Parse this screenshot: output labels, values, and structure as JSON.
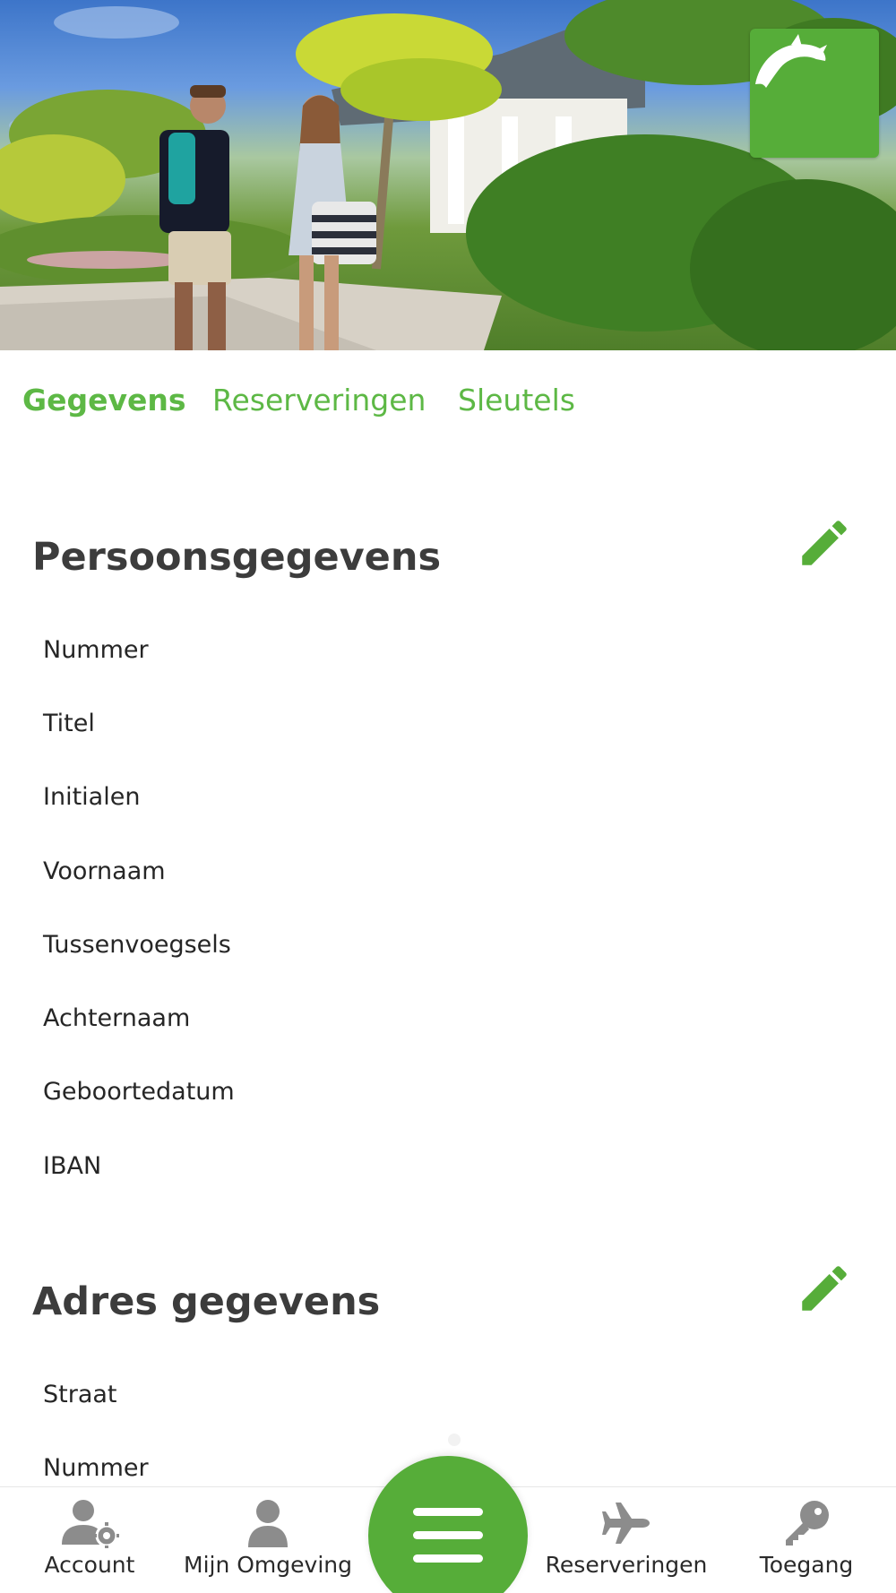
{
  "tabs": [
    "Gegevens",
    "Reserveringen",
    "Sleutels"
  ],
  "active_tab": "Gegevens",
  "personal": {
    "title": "Persoonsgegevens",
    "fields": [
      "Nummer",
      "Titel",
      "Initialen",
      "Voornaam",
      "Tussenvoegsels",
      "Achternaam",
      "Geboortedatum",
      "IBAN"
    ]
  },
  "address": {
    "title": "Adres gegevens",
    "fields": [
      "Straat",
      "Nummer"
    ]
  },
  "bottom_nav": {
    "account": "Account",
    "omgeving": "Mijn Omgeving",
    "reserveringen": "Reserveringen",
    "toegang": "Toegang"
  },
  "icons": {
    "logo": "dolphin-icon",
    "edit": "pencil-icon",
    "menu": "hamburger-menu-icon",
    "account": "user-gear-icon",
    "omgeving": "user-icon",
    "reserveringen": "airplane-icon",
    "toegang": "key-icon"
  },
  "colors": {
    "accent": "#56ad39",
    "tab_text": "#5db845",
    "heading": "#3c3c3c"
  }
}
